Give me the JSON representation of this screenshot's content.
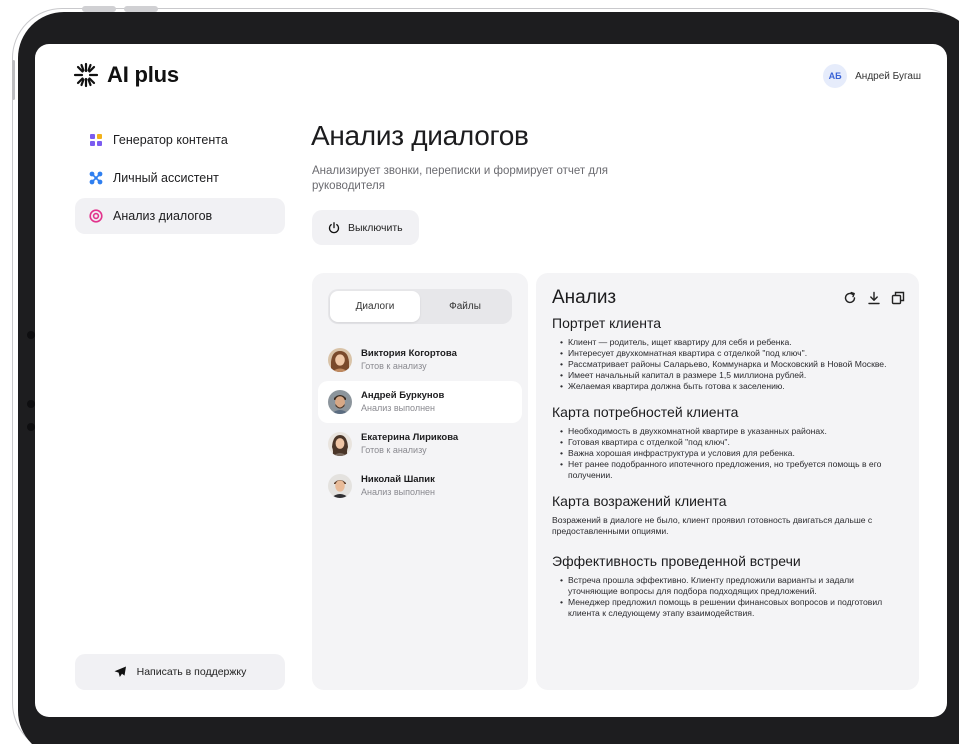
{
  "brand": {
    "name": "AI plus"
  },
  "user": {
    "initials": "АБ",
    "name": "Андрей Бугаш"
  },
  "sidebar": {
    "items": [
      {
        "label": "Генератор контента",
        "icon": "grid-icon",
        "active": false
      },
      {
        "label": "Личный ассистент",
        "icon": "nodes-icon",
        "active": false
      },
      {
        "label": "Анализ диалогов",
        "icon": "target-icon",
        "active": true
      }
    ],
    "support_label": "Написать в поддержку"
  },
  "main": {
    "title": "Анализ диалогов",
    "subtitle": "Анализирует звонки, переписки и формирует отчет для руководителя",
    "power_label": "Выключить"
  },
  "dialogs": {
    "tabs": [
      {
        "label": "Диалоги",
        "active": true
      },
      {
        "label": "Файлы",
        "active": false
      }
    ],
    "contacts": [
      {
        "name": "Виктория Когортова",
        "status": "Готов к анализу",
        "active": false
      },
      {
        "name": "Андрей Буркунов",
        "status": "Анализ выполнен",
        "active": true
      },
      {
        "name": "Екатерина Лирикова",
        "status": "Готов к анализу",
        "active": false
      },
      {
        "name": "Николай Шапик",
        "status": "Анализ выполнен",
        "active": false
      }
    ]
  },
  "analysis": {
    "title": "Анализ",
    "sections": [
      {
        "title": "Портрет клиента",
        "bullets": [
          "Клиент — родитель, ищет квартиру для себя и ребенка.",
          "Интересует двухкомнатная квартира с отделкой \"под ключ\".",
          "Рассматривает районы Саларьево, Коммунарка и Московский в Новой Москве.",
          "Имеет начальный капитал в размере 1,5 миллиона рублей.",
          "Желаемая квартира должна быть готова к заселению."
        ]
      },
      {
        "title": "Карта потребностей клиента",
        "bullets": [
          "Необходимость в двухкомнатной квартире в указанных районах.",
          "Готовая квартира с отделкой \"под ключ\".",
          "Важна хорошая инфраструктура и условия для ребенка.",
          "Нет ранее подобранного ипотечного предложения, но требуется помощь в его получении."
        ]
      },
      {
        "title": "Карта возражений клиента",
        "text": "Возражений в диалоге не было, клиент проявил готовность двигаться дальше с предоставленными опциями."
      },
      {
        "title": "Эффективность проведенной встречи",
        "bullets": [
          "Встреча прошла эффективно. Клиенту предложили варианты и задали уточняющие вопросы для подбора подходящих предложений.",
          "Менеджер предложил помощь в решении финансовых вопросов и подготовил клиента к следующему этапу взаимодействия."
        ]
      }
    ]
  },
  "colors": {
    "accent_purple": "#7b5cf0",
    "accent_blue": "#2f7ff0",
    "accent_pink": "#e2338c",
    "panel_bg": "#f4f4f6"
  }
}
